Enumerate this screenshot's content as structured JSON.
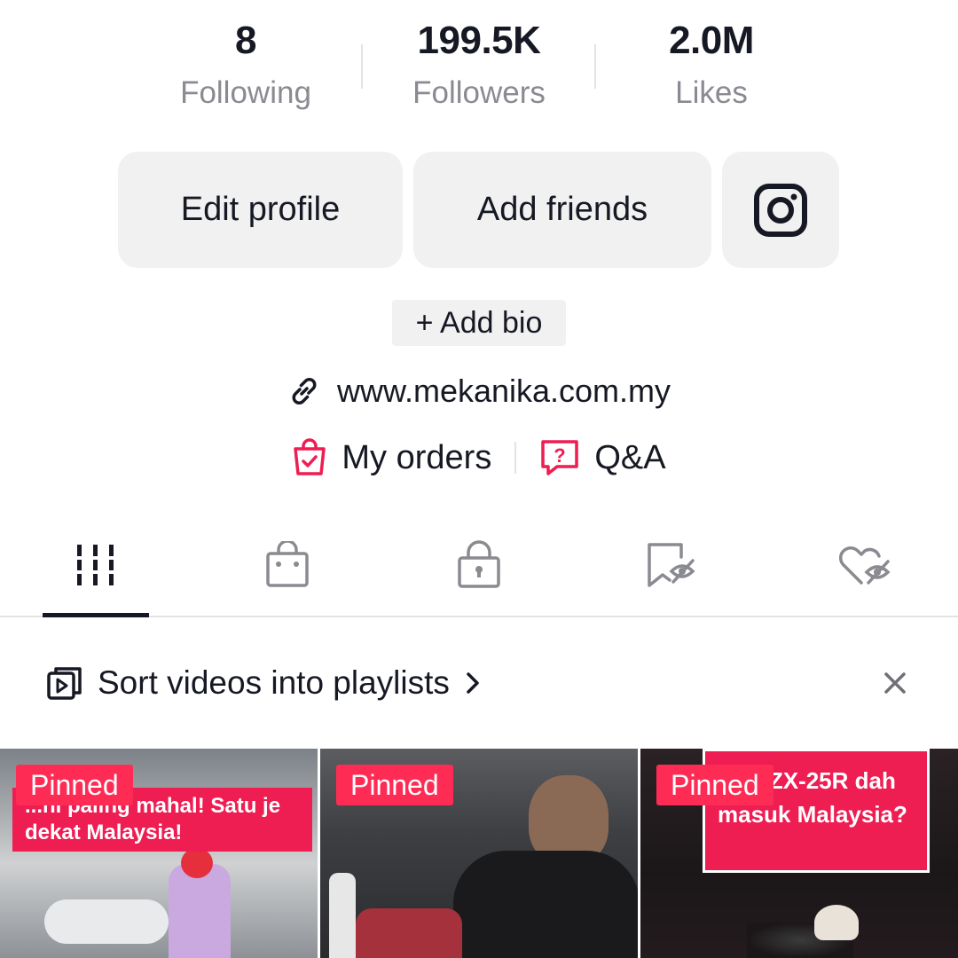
{
  "stats": {
    "following": {
      "value": "8",
      "label": "Following"
    },
    "followers": {
      "value": "199.5K",
      "label": "Followers"
    },
    "likes": {
      "value": "2.0M",
      "label": "Likes"
    }
  },
  "actions": {
    "edit_profile": "Edit profile",
    "add_friends": "Add friends",
    "instagram_icon": "instagram-icon"
  },
  "bio": {
    "add_bio": "+ Add bio"
  },
  "link": {
    "url": "www.mekanika.com.my",
    "icon": "link-icon"
  },
  "shortcuts": {
    "my_orders": "My orders",
    "qa": "Q&A",
    "accent": "#ee1d52"
  },
  "tabs": [
    {
      "name": "videos",
      "icon": "grid-icon",
      "active": true
    },
    {
      "name": "shop",
      "icon": "shopping-bag-icon",
      "active": false
    },
    {
      "name": "private",
      "icon": "lock-icon",
      "active": false
    },
    {
      "name": "reposts",
      "icon": "bookmark-hidden-icon",
      "active": false
    },
    {
      "name": "liked",
      "icon": "heart-hidden-icon",
      "active": false
    }
  ],
  "playlist_banner": {
    "text": "Sort videos into playlists",
    "icon": "playlist-icon"
  },
  "videos": [
    {
      "badge": "Pinned",
      "caption": "...ni paling mahal! Satu je dekat Malaysia!"
    },
    {
      "badge": "Pinned",
      "caption": ""
    },
    {
      "badge": "Pinned",
      "caption": "saki ZX-25R dah masuk Malaysia?"
    }
  ],
  "colors": {
    "text": "#161823",
    "secondary": "#8a8b91",
    "button_bg": "#f1f1f2",
    "pinned": "#fe2c55"
  }
}
